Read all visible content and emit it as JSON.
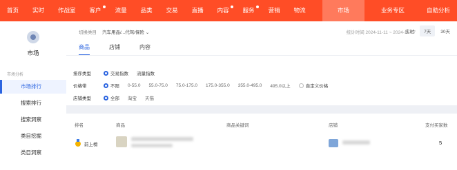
{
  "nav": {
    "items": [
      {
        "label": "首页",
        "dot": false,
        "active": false
      },
      {
        "label": "实时",
        "dot": false,
        "active": false
      },
      {
        "label": "作战室",
        "dot": false,
        "active": false
      },
      {
        "label": "客户",
        "dot": true,
        "active": false
      },
      {
        "label": "流量",
        "dot": false,
        "active": false
      },
      {
        "label": "品类",
        "dot": false,
        "active": false
      },
      {
        "label": "交易",
        "dot": false,
        "active": false
      },
      {
        "label": "直播",
        "dot": false,
        "active": false
      },
      {
        "label": "内容",
        "dot": true,
        "active": false
      },
      {
        "label": "服务",
        "dot": true,
        "active": false
      },
      {
        "label": "营销",
        "dot": false,
        "active": false
      },
      {
        "label": "物流",
        "dot": false,
        "active": false
      },
      {
        "label": "市场",
        "dot": false,
        "active": true
      },
      {
        "label": "业务专区",
        "dot": false,
        "active": false
      },
      {
        "label": "自助分析",
        "dot": false,
        "active": false
      }
    ]
  },
  "sidebar": {
    "title": "市场",
    "group": "市场分析",
    "items": [
      {
        "label": "市场排行",
        "active": true
      },
      {
        "label": "搜索排行",
        "active": false
      },
      {
        "label": "搜索洞察",
        "active": false
      },
      {
        "label": "类目挖掘",
        "active": false
      },
      {
        "label": "类目洞察",
        "active": false
      }
    ]
  },
  "header": {
    "switch_label": "切换类目",
    "category": "汽车用品/...代驾/保险 ⌄",
    "date_range": "统计时间 2024-11-11 ~ 2024-11-17",
    "period": [
      {
        "label": "实时",
        "on": false
      },
      {
        "label": "7天",
        "on": true
      },
      {
        "label": "30天",
        "on": false
      }
    ]
  },
  "tabs": [
    {
      "label": "商品",
      "active": true
    },
    {
      "label": "店铺",
      "active": false
    },
    {
      "label": "内容",
      "active": false
    }
  ],
  "filters": {
    "rank_type": {
      "label": "排序类型",
      "options": [
        {
          "label": "交易指数",
          "on": true
        },
        {
          "label": "流量指数",
          "on": false
        }
      ]
    },
    "price": {
      "label": "价格带",
      "options": [
        {
          "label": "不限",
          "on": true
        },
        {
          "label": "0-55.0",
          "on": false
        },
        {
          "label": "55.0-75.0",
          "on": false
        },
        {
          "label": "75.0-175.0",
          "on": false
        },
        {
          "label": "175.0-355.0",
          "on": false
        },
        {
          "label": "355.0-495.0",
          "on": false
        },
        {
          "label": "495.0以上",
          "on": false
        },
        {
          "label": "自定义价格",
          "on": false
        }
      ]
    },
    "shop_type": {
      "label": "店铺类型",
      "options": [
        {
          "label": "全部",
          "on": true
        },
        {
          "label": "淘宝",
          "on": false
        },
        {
          "label": "天猫",
          "on": false
        }
      ]
    }
  },
  "table": {
    "headers": {
      "rank": "排名",
      "product": "商品",
      "keyword": "商品关键词",
      "shop": "店铺",
      "buyers": "支付买家数"
    },
    "rows": [
      {
        "rank": "前上榜",
        "buyers": "5"
      }
    ]
  }
}
